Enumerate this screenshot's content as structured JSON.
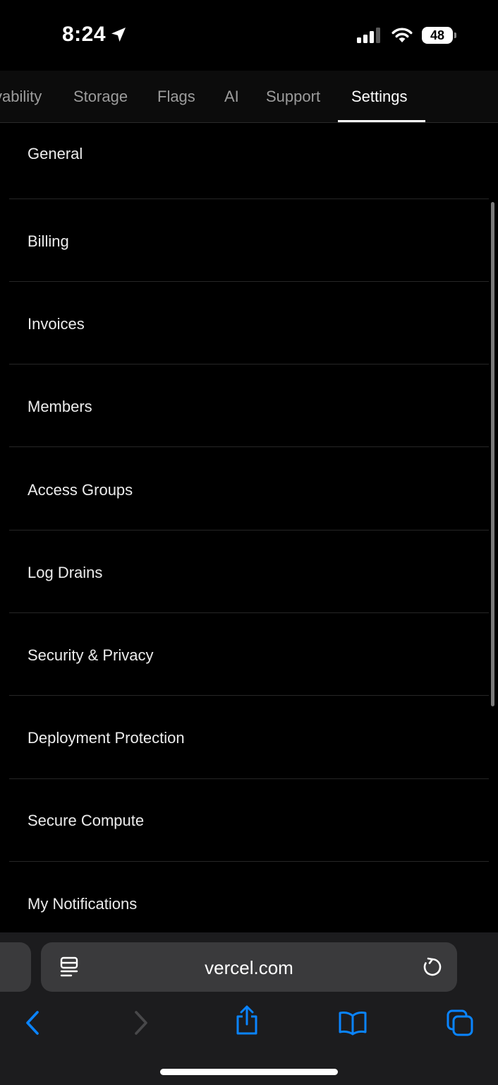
{
  "status_bar": {
    "time": "8:24",
    "battery": "48"
  },
  "tabs": [
    {
      "label": "vability",
      "active": false
    },
    {
      "label": "Storage",
      "active": false
    },
    {
      "label": "Flags",
      "active": false
    },
    {
      "label": "AI",
      "active": false
    },
    {
      "label": "Support",
      "active": false
    },
    {
      "label": "Settings",
      "active": true
    }
  ],
  "settings_menu": {
    "items": [
      {
        "label": "General"
      },
      {
        "label": "Billing"
      },
      {
        "label": "Invoices"
      },
      {
        "label": "Members"
      },
      {
        "label": "Access Groups"
      },
      {
        "label": "Log Drains"
      },
      {
        "label": "Security & Privacy"
      },
      {
        "label": "Deployment Protection"
      },
      {
        "label": "Secure Compute"
      },
      {
        "label": "My Notifications"
      }
    ]
  },
  "browser": {
    "url": "vercel.com",
    "icons": [
      "reader-icon",
      "reload-icon",
      "back-icon",
      "forward-icon",
      "share-icon",
      "bookmarks-icon",
      "tabs-icon"
    ],
    "accent_color": "#0a84ff",
    "disabled_color": "#48484a"
  }
}
